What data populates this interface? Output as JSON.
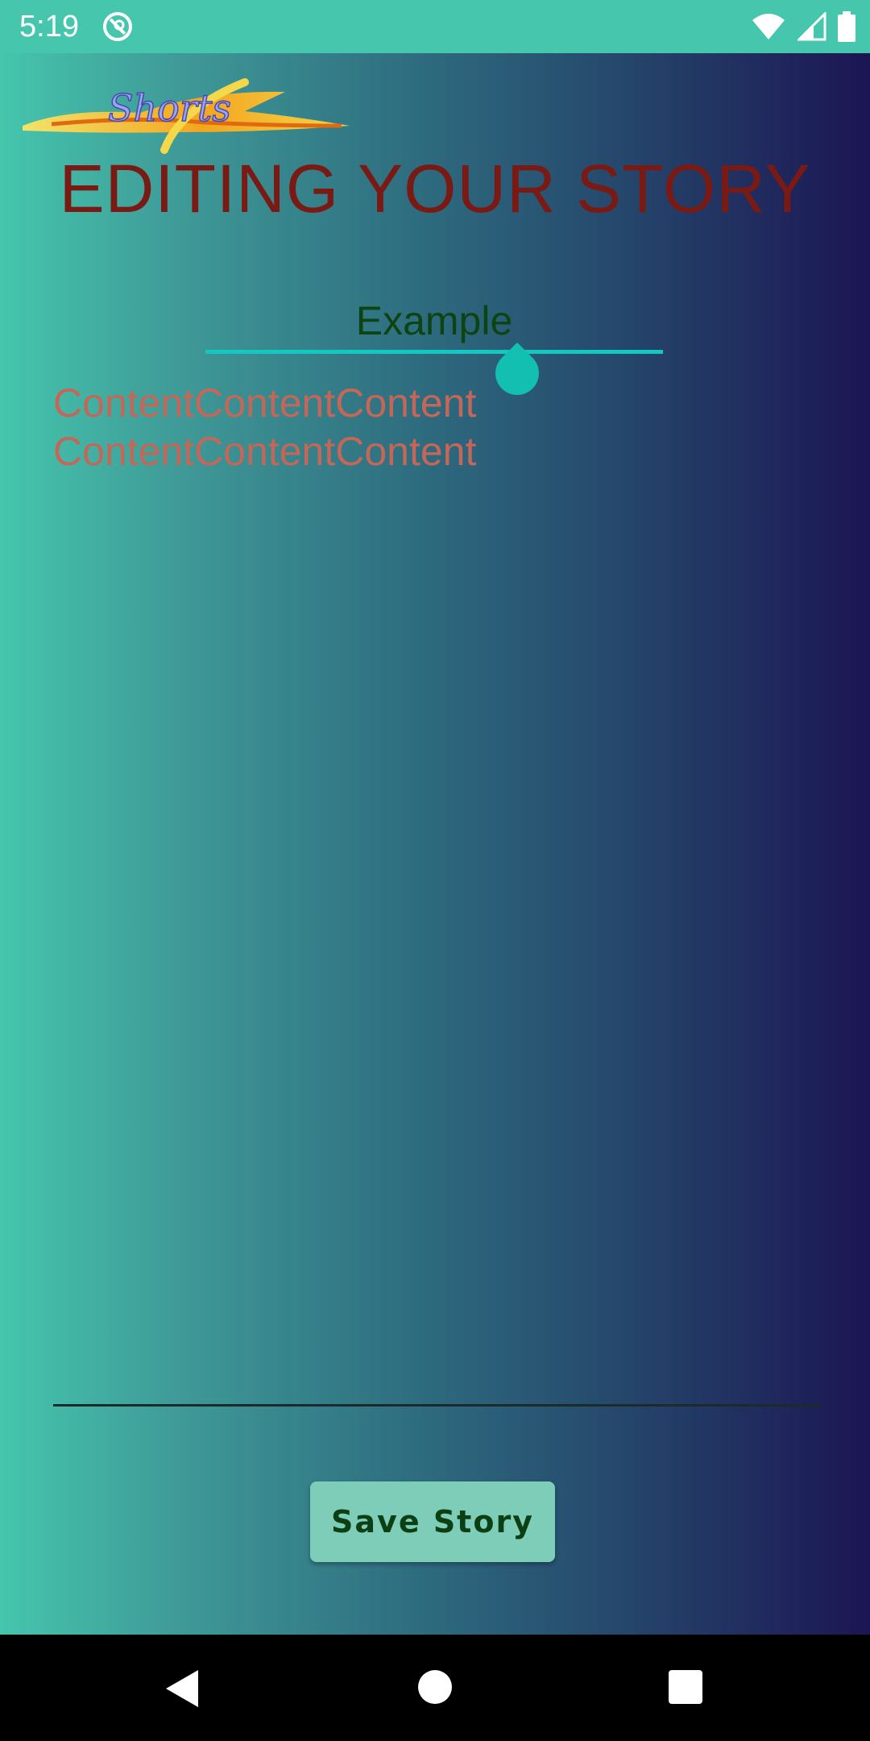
{
  "status_bar": {
    "time": "5:19",
    "background": "#45c6ad",
    "icons": [
      "app-notification-icon",
      "wifi-icon",
      "cellular-signal-icon",
      "battery-icon"
    ]
  },
  "app": {
    "logo_text": "Shorts",
    "page_title": "EDITING YOUR STORY",
    "title_input": {
      "value": "Example"
    },
    "content_input": {
      "value": "ContentContentContent\nContentContentContent"
    },
    "save_button": {
      "label": "Save Story"
    },
    "colors": {
      "gradient_start": "#45c6ad",
      "gradient_end": "#1c1553",
      "title_color": "#7a1a14",
      "content_color": "#c46758",
      "accent": "#12c8c0",
      "button_bg": "#7ecdb9",
      "button_text": "#0c3f12"
    }
  },
  "nav_bar": {
    "icons": [
      "back-icon",
      "home-icon",
      "recents-icon"
    ]
  }
}
